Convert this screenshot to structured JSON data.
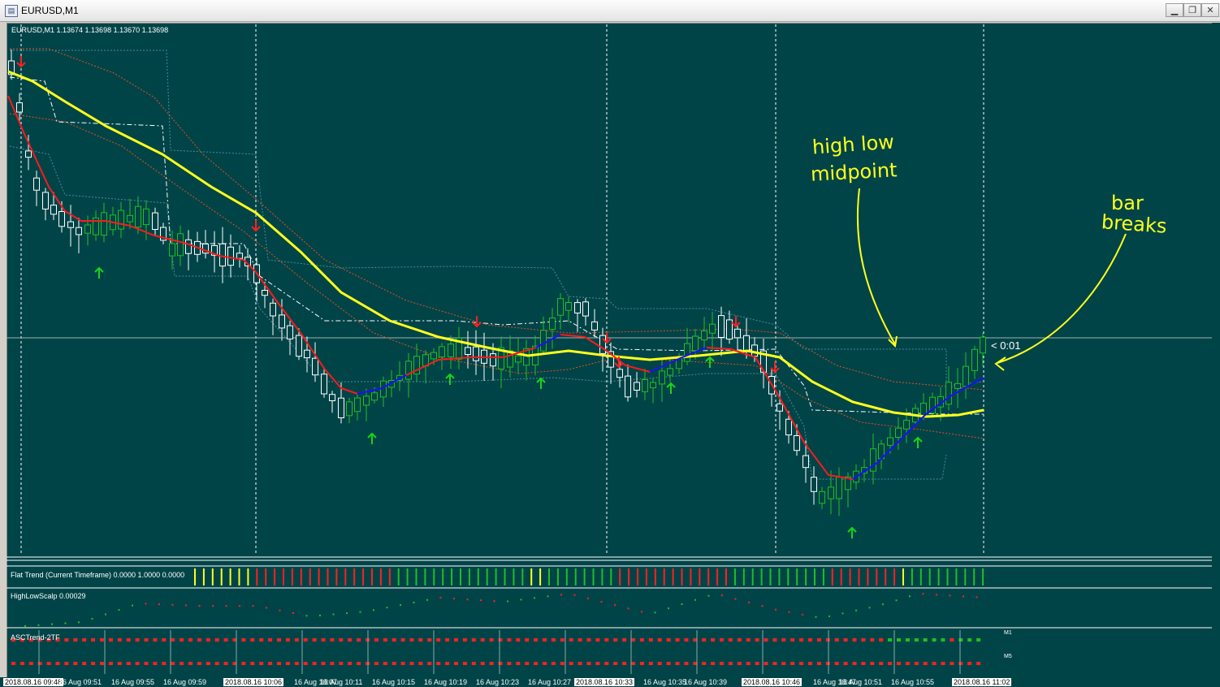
{
  "window": {
    "title": "EURUSD,M1",
    "buttons": [
      "minimize",
      "restore",
      "close"
    ]
  },
  "chart": {
    "header": "EURUSD,M1  1.13674 1.13698 1.13670 1.13698",
    "timer_label": "< 0:01",
    "annotations": {
      "midpoint_note_line1": "high low",
      "midpoint_note_line2": "midpoint",
      "bar_note_line1": "bar",
      "bar_note_line2": "breaks"
    },
    "colors": {
      "background": "#004448",
      "bull_candle": "#1fc01f",
      "bear_candle": "#ffffff",
      "slow_ma": "#ffff1e",
      "fast_ma_down": "#ff1a1a",
      "fast_ma_up": "#1010ff",
      "signal_up": "#19d419",
      "signal_down": "#ff2020",
      "annotation": "#ffff1e"
    },
    "icons": [
      "down-arrow-icon",
      "up-arrow-icon"
    ]
  },
  "indicators": {
    "flat_trend_label": "Flat Trend (Current Timeframe) 0.0000 1.0000 0.0000",
    "highlow_label": "HighLowScalp 0.00029",
    "asc_label": "ASCTrend-2TF",
    "asc_tf1": "M1",
    "asc_tf2": "M5"
  },
  "time_axis": [
    {
      "text": "2018.08.16 09:48",
      "hl": true
    },
    {
      "text": "16 Aug 09:51",
      "hl": false
    },
    {
      "text": "16 Aug 09:55",
      "hl": false
    },
    {
      "text": "16 Aug 09:59",
      "hl": false
    },
    {
      "text": "2018.08.16 10:06",
      "hl": true
    },
    {
      "text": "16 Aug 10:07",
      "hl": false
    },
    {
      "text": "16 Aug 10:11",
      "hl": false
    },
    {
      "text": "16 Aug 10:15",
      "hl": false
    },
    {
      "text": "16 Aug 10:19",
      "hl": false
    },
    {
      "text": "16 Aug 10:23",
      "hl": false
    },
    {
      "text": "16 Aug 10:27",
      "hl": false
    },
    {
      "text": "2018.08.16 10:33",
      "hl": true
    },
    {
      "text": "16 Aug 10:35",
      "hl": false
    },
    {
      "text": "16 Aug 10:39",
      "hl": false
    },
    {
      "text": "2018.08.16 10:46",
      "hl": true
    },
    {
      "text": "16 Aug 10:47",
      "hl": false
    },
    {
      "text": "16 Aug 10:51",
      "hl": false
    },
    {
      "text": "16 Aug 10:55",
      "hl": false
    },
    {
      "text": "2018.08.16 11:02",
      "hl": true
    }
  ]
}
